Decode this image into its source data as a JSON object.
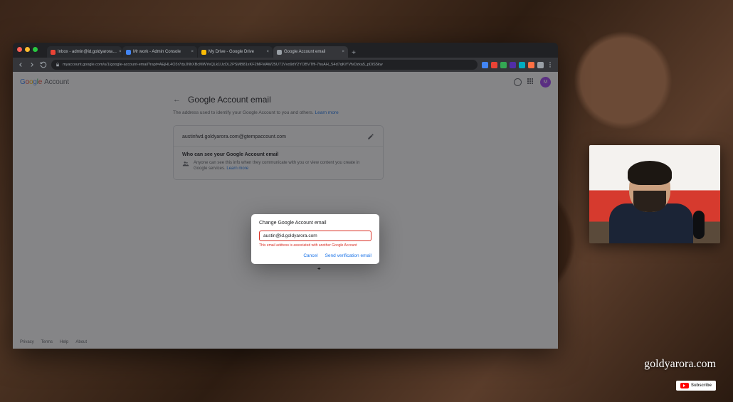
{
  "tabs": [
    {
      "favColor": "#ea4335",
      "label": "Inbox - admin@id.goldyarora…",
      "active": false
    },
    {
      "favColor": "#4285f4",
      "label": "Mr work - Admin Console",
      "active": false
    },
    {
      "favColor": "#fbbc05",
      "label": "My Drive - Google Drive",
      "active": false
    },
    {
      "favColor": "#9aa0a6",
      "label": "Google Account email",
      "active": true
    }
  ],
  "omnibox": {
    "url": "myaccount.google.com/u/1/google-account-email?rapt=AEjHL4O3r7dyJNhXBcMWYeQLk1UzDL2PSMB81xKF2MFMAW25U71Vvo9dY2YOBVTffi-7huAH_S4d7qKiYVfvDzka5_pDiS5kw"
  },
  "extColors": [
    "#4285f4",
    "#ea4335",
    "#34a853",
    "#512da8",
    "#00acc1",
    "#ff7043",
    "#9aa0a6",
    "#ffffff"
  ],
  "logo": {
    "g": "G",
    "o1": "o",
    "o2": "o",
    "g2": "g",
    "l": "l",
    "e": "e",
    "account": "Account"
  },
  "avatarInitial": "M",
  "page": {
    "title": "Google Account email",
    "subtitle": "The address used to identify your Google Account to you and others.",
    "learnMore": "Learn more",
    "currentEmail": "austinfwd.goldyarora.com@gtempaccount.com",
    "whoTitle": "Who can see your Google Account email",
    "whoBody": "Anyone can see this info when they communicate with you or view content you create in Google services.",
    "whoLearn": "Learn more"
  },
  "dialog": {
    "title": "Change Google Account email",
    "value": "austin@id.goldyarora.com",
    "error": "This email address is associated with another Google Account",
    "cancel": "Cancel",
    "send": "Send verification email"
  },
  "footer": [
    "Privacy",
    "Terms",
    "Help",
    "About"
  ],
  "watermark": "goldyarora.com",
  "subscribe": "Subscribe"
}
